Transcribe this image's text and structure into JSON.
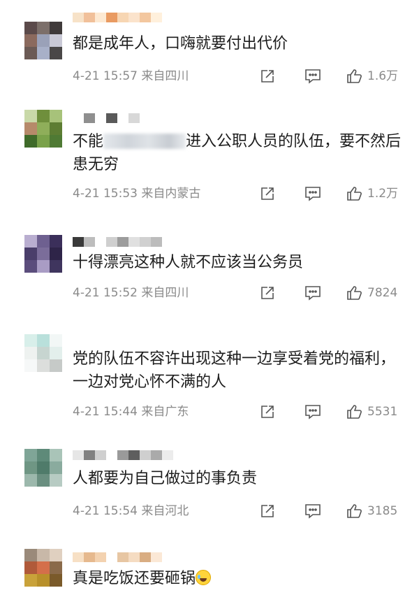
{
  "comments": [
    {
      "text": "都是成年人，口嗨就要付出代价",
      "time": "4-21 15:57 来自四川",
      "likes": "1.6万",
      "avatar_colors": [
        "#5b4a4a",
        "#7c6f6a",
        "#3f3a3a",
        "#8b6a5e",
        "#9aa1b8",
        "#c9c9d6",
        "#6b5a55",
        "#a8b0c8",
        "#4a4747"
      ],
      "name_colors": [
        "#f7e2c8",
        "#f1c09a",
        "#fde9d2",
        "#e99b62",
        "#f7d6b3",
        "#fbe3cc",
        "#f3c79f",
        "#fff0dc"
      ]
    },
    {
      "text_before": "不能",
      "text_after": "进入公职人员的队伍，要不然后患无穷",
      "time": "4-21 15:53 来自内蒙古",
      "likes": "1.2万",
      "avatar_colors": [
        "#c9d9a8",
        "#6f8f3c",
        "#a7c27a",
        "#b68a6a",
        "#8fae5a",
        "#5d7d33",
        "#3f6b2a",
        "#7aa24a",
        "#4f7a34"
      ],
      "name_colors": [
        "#ffffff",
        "#8f8f8f",
        "#ffffff",
        "#5a5a5a",
        "#ffffff",
        "#d8d8d8"
      ]
    },
    {
      "text": "十得漂亮这种人就不应该当公务员",
      "time": "4-21 15:52 来自四川",
      "likes": "7824",
      "avatar_colors": [
        "#b9aed0",
        "#6e6090",
        "#3b2f5a",
        "#4a3e6a",
        "#7b6d9a",
        "#2e2448",
        "#5b4d7c",
        "#a99cc4",
        "#3f355e"
      ],
      "name_colors": [
        "#3a3a3a",
        "#bdbdbd",
        "#ffffff",
        "#cfcfcf",
        "#9c9c9c",
        "#e0e0e0",
        "#d0d0d0",
        "#bcbcbc"
      ]
    },
    {
      "text": "党的队伍不容许出现这种一边享受着党的福利，一边对党心怀不满的人",
      "time": "4-21 15:44 来自广东",
      "likes": "5531",
      "avatar_colors": [
        "#d8efea",
        "#b9e0db",
        "#f2f7f6",
        "#eef2f0",
        "#c7d5d0",
        "#e3efec",
        "#f6f8f8",
        "#dcdedc",
        "#c6cac8"
      ],
      "name_colors": []
    },
    {
      "text": "人都要为自己做过的事负责",
      "time": "4-21 15:54 来自河北",
      "likes": "3185",
      "avatar_colors": [
        "#7fa597",
        "#5e8a79",
        "#a9c4b8",
        "#6f9684",
        "#4f7b6a",
        "#8aab9e",
        "#9cb8ac",
        "#6a8f80",
        "#b7cbc3"
      ],
      "name_colors": [
        "#e6e6e6",
        "#808080",
        "#cfcfcf",
        "#ffffff",
        "#9a9a9a",
        "#5e5e5e",
        "#cfcfcf",
        "#aaaaaa",
        "#ececec"
      ]
    },
    {
      "text": "真是吃饭还要砸锅",
      "time": "",
      "likes": "",
      "avatar_colors": [
        "#9a8a7a",
        "#c8b8a8",
        "#e0d0c0",
        "#b05a3a",
        "#d46f4a",
        "#8a6a4a",
        "#c9a23a",
        "#b8902a",
        "#7a5a2a"
      ],
      "name_colors": [
        "#f7e0c5",
        "#e6b98e",
        "#f3d2b0",
        "#ffffff",
        "#e7c6a3",
        "#f5dcc2",
        "#d9ad82",
        "#fbe8d6"
      ]
    }
  ]
}
